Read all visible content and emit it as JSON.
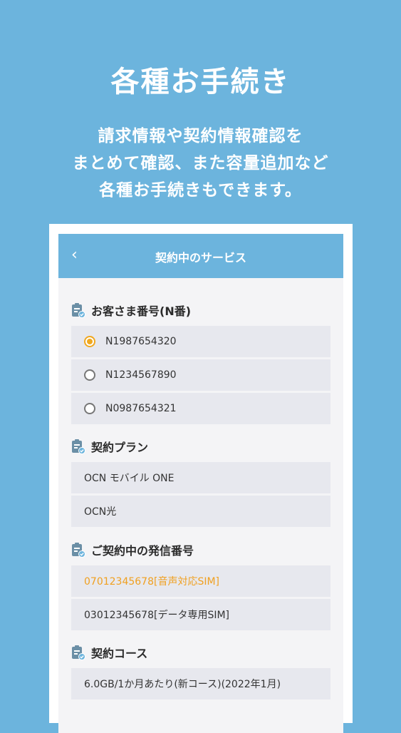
{
  "hero": {
    "title": "各種お手続き",
    "subtitle_lines": [
      "請求情報や契約情報確認を",
      "まとめて確認、また容量追加など",
      "各種お手続きもできます。"
    ]
  },
  "appbar": {
    "back_glyph": "‹",
    "title": "契約中のサービス"
  },
  "sections": {
    "customer_number": {
      "heading": "お客さま番号(N番)",
      "options": [
        {
          "label": "N1987654320",
          "selected": true
        },
        {
          "label": "N1234567890",
          "selected": false
        },
        {
          "label": "N0987654321",
          "selected": false
        }
      ]
    },
    "plan": {
      "heading": "契約プラン",
      "items": [
        "OCN モバイル ONE",
        "OCN光"
      ]
    },
    "numbers": {
      "heading": "ご契約中の発信番号",
      "items": [
        "07012345678[音声対応SIM]",
        "03012345678[データ専用SIM]"
      ]
    },
    "course": {
      "heading": "契約コース",
      "items": [
        "6.0GB/1か月あたり(新コース)(2022年1月)"
      ]
    }
  },
  "colors": {
    "background": "#6cb4dd",
    "accent": "#f0a820",
    "row": "#e7e8ee"
  },
  "icons": {
    "section_icon": "clipboard-check-icon",
    "back_icon": "chevron-left-icon"
  }
}
